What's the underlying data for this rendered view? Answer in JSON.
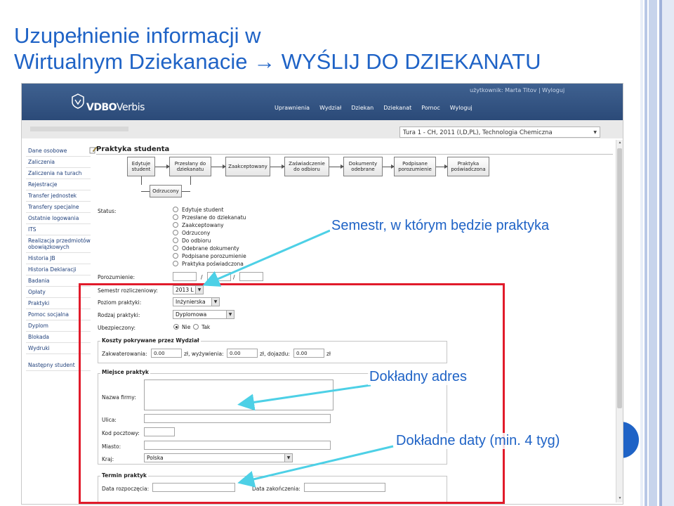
{
  "slide": {
    "title_line1": "Uzupełnienie informacji w",
    "title_line2": "Wirtualnym Dziekanacie → WYŚLIJ DO DZIEKANATU"
  },
  "app": {
    "user_bar": "użytkownik: Marta Titov | Wyloguj",
    "logo_bold": "VDBO",
    "logo_thin": "Verbis",
    "nav": [
      "Uprawnienia",
      "Wydział",
      "Dziekan",
      "Dziekanat",
      "Pomoc",
      "Wyloguj"
    ],
    "tura_select": "Tura 1 - CH, 2011 (I,D,PL), Technologia Chemiczna"
  },
  "sidebar": {
    "items": [
      "Dane osobowe",
      "Zaliczenia",
      "Zaliczenia na turach",
      "Rejestracje",
      "Transfer jednostek",
      "Transfery specjalne",
      "Ostatnie logowania",
      "ITS",
      "Realizacja przedmiotów obowiązkowych",
      "Historia JB",
      "Historia Deklaracji",
      "Badania",
      "Opłaty",
      "Praktyki",
      "Pomoc socjalna",
      "Dyplom",
      "Blokada",
      "Wydruki"
    ],
    "next_student": "Następny student"
  },
  "content": {
    "title": "Praktyka studenta",
    "workflow": [
      "Edytuje student",
      "Przesłany do dziekanatu",
      "Zaakceptowany",
      "Zaświadczenie do odbioru",
      "Dokumenty odebrane",
      "Podpisane porozumienie",
      "Praktyka poświadczona"
    ],
    "workflow_branch": "Odrzucony",
    "status_label": "Status:",
    "status_options": [
      "Edytuje student",
      "Przesłane do dziekanatu",
      "Zaakceptowany",
      "Odrzucony",
      "Do odbioru",
      "Odebrane dokumenty",
      "Podpisane porozumienie",
      "Praktyka poświadczona"
    ],
    "agreement_label": "Porozumienie:",
    "agreement_sep": "/",
    "semester_label": "Semestr rozliczeniowy:",
    "semester_value": "2013 L",
    "level_label": "Poziom praktyki:",
    "level_value": "Inżynierska",
    "type_label": "Rodzaj praktyki:",
    "type_value": "Dyplomowa",
    "insured_label": "Ubezpieczony:",
    "insured_no": "Nie",
    "insured_yes": "Tak",
    "costs_legend": "Koszty pokrywane przez Wydział",
    "costs": {
      "housing_label": "Zakwaterowania:",
      "housing_value": "0.00",
      "food_label": "zł, wyżywienia:",
      "food_value": "0.00",
      "travel_label": "zł, dojazdu:",
      "travel_value": "0.00",
      "currency": "zł"
    },
    "place_legend": "Miejsce praktyk",
    "company_label": "Nazwa firmy:",
    "street_label": "Ulica:",
    "postal_label": "Kod pocztowy:",
    "city_label": "Miasto:",
    "country_label": "Kraj:",
    "country_value": "Polska",
    "term_legend": "Termin praktyk",
    "start_label": "Data rozpoczęcia:",
    "end_label": "Data zakończenia:"
  },
  "annotations": {
    "semester": "Semestr, w którym będzie praktyka",
    "address": "Dokładny adres",
    "dates": "Dokładne daty (min. 4 tyg)"
  },
  "colors": {
    "title_blue": "#1f63c6",
    "highlight_red": "#e11b2b",
    "arrow_cyan": "#4dd0e6",
    "header_navy": "#2b4a78"
  }
}
